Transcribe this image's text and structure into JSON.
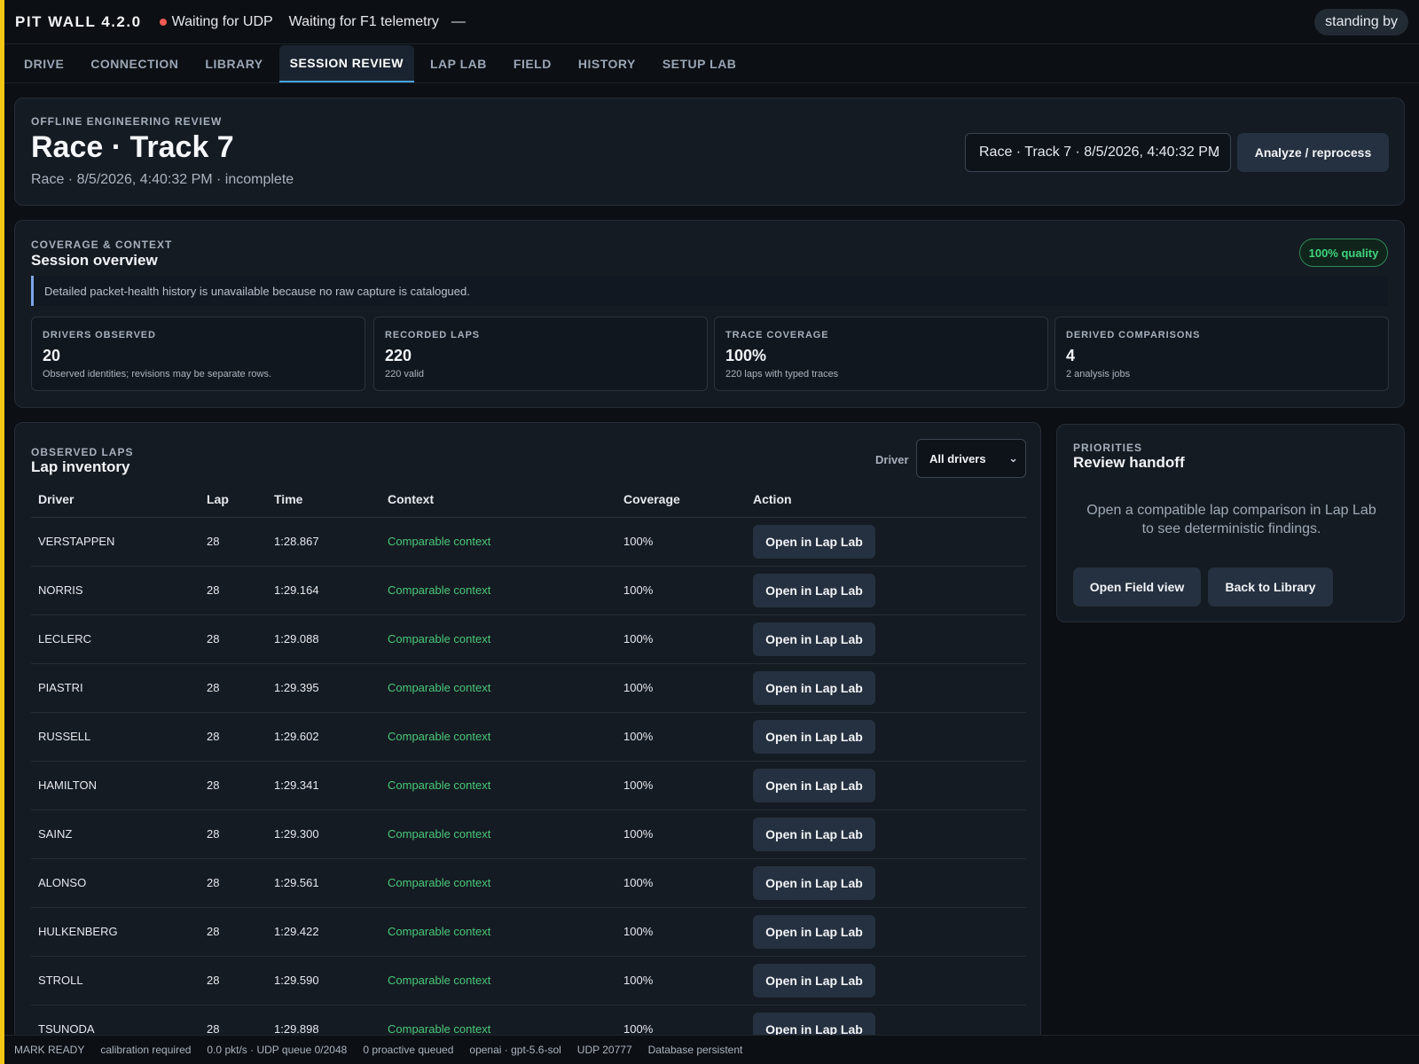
{
  "app": {
    "title": "PIT WALL 4.2.0",
    "udp_status": "Waiting for UDP",
    "telemetry_status": "Waiting for F1 telemetry",
    "dash": "—",
    "standby": "standing by"
  },
  "nav": {
    "tabs": [
      {
        "label": "DRIVE"
      },
      {
        "label": "CONNECTION"
      },
      {
        "label": "LIBRARY"
      },
      {
        "label": "SESSION REVIEW"
      },
      {
        "label": "LAP LAB"
      },
      {
        "label": "FIELD"
      },
      {
        "label": "HISTORY"
      },
      {
        "label": "SETUP LAB"
      }
    ],
    "active": "SESSION REVIEW"
  },
  "header": {
    "eyebrow": "OFFLINE ENGINEERING REVIEW",
    "title": "Race · Track 7",
    "subtitle": "Race · 8/5/2026, 4:40:32 PM · incomplete",
    "session_select": "Race · Track 7 · 8/5/2026, 4:40:32 PM",
    "analyze_label": "Analyze / reprocess"
  },
  "coverage": {
    "eyebrow": "COVERAGE & CONTEXT",
    "title": "Session overview",
    "quality_badge": "100% quality",
    "notice": "Detailed packet-health history is unavailable because no raw capture is catalogued.",
    "stats": [
      {
        "label": "DRIVERS OBSERVED",
        "value": "20",
        "note": "Observed identities; revisions may be separate rows."
      },
      {
        "label": "RECORDED LAPS",
        "value": "220",
        "note": "220 valid"
      },
      {
        "label": "TRACE COVERAGE",
        "value": "100%",
        "note": "220 laps with typed traces"
      },
      {
        "label": "DERIVED COMPARISONS",
        "value": "4",
        "note": "2 analysis jobs"
      }
    ]
  },
  "laps": {
    "eyebrow": "OBSERVED LAPS",
    "title": "Lap inventory",
    "driver_label": "Driver",
    "driver_select": "All drivers",
    "columns": [
      "Driver",
      "Lap",
      "Time",
      "Context",
      "Coverage",
      "Action"
    ],
    "rows": [
      {
        "driver": "VERSTAPPEN",
        "lap": "28",
        "time": "1:28.867",
        "context": "Comparable context",
        "coverage": "100%",
        "action": "Open in Lap Lab"
      },
      {
        "driver": "NORRIS",
        "lap": "28",
        "time": "1:29.164",
        "context": "Comparable context",
        "coverage": "100%",
        "action": "Open in Lap Lab"
      },
      {
        "driver": "LECLERC",
        "lap": "28",
        "time": "1:29.088",
        "context": "Comparable context",
        "coverage": "100%",
        "action": "Open in Lap Lab"
      },
      {
        "driver": "PIASTRI",
        "lap": "28",
        "time": "1:29.395",
        "context": "Comparable context",
        "coverage": "100%",
        "action": "Open in Lap Lab"
      },
      {
        "driver": "RUSSELL",
        "lap": "28",
        "time": "1:29.602",
        "context": "Comparable context",
        "coverage": "100%",
        "action": "Open in Lap Lab"
      },
      {
        "driver": "HAMILTON",
        "lap": "28",
        "time": "1:29.341",
        "context": "Comparable context",
        "coverage": "100%",
        "action": "Open in Lap Lab"
      },
      {
        "driver": "SAINZ",
        "lap": "28",
        "time": "1:29.300",
        "context": "Comparable context",
        "coverage": "100%",
        "action": "Open in Lap Lab"
      },
      {
        "driver": "ALONSO",
        "lap": "28",
        "time": "1:29.561",
        "context": "Comparable context",
        "coverage": "100%",
        "action": "Open in Lap Lab"
      },
      {
        "driver": "HULKENBERG",
        "lap": "28",
        "time": "1:29.422",
        "context": "Comparable context",
        "coverage": "100%",
        "action": "Open in Lap Lab"
      },
      {
        "driver": "STROLL",
        "lap": "28",
        "time": "1:29.590",
        "context": "Comparable context",
        "coverage": "100%",
        "action": "Open in Lap Lab"
      },
      {
        "driver": "TSUNODA",
        "lap": "28",
        "time": "1:29.898",
        "context": "Comparable context",
        "coverage": "100%",
        "action": "Open in Lap Lab"
      }
    ]
  },
  "priorities": {
    "eyebrow": "PRIORITIES",
    "title": "Review handoff",
    "message": "Open a compatible lap comparison in Lap Lab to see deterministic findings.",
    "field_button": "Open Field view",
    "library_button": "Back to Library"
  },
  "statusbar": {
    "items": [
      "MARK READY",
      "calibration required",
      "0.0 pkt/s · UDP queue 0/2048",
      "0 proactive queued",
      "openai · gpt-5.6-sol",
      "UDP 20777",
      "Database persistent"
    ]
  },
  "colors": {
    "accent": "#f3c614",
    "status_dot": "#ef5a52",
    "positive": "#49c87a",
    "tab_underline": "#4aa3e0"
  }
}
